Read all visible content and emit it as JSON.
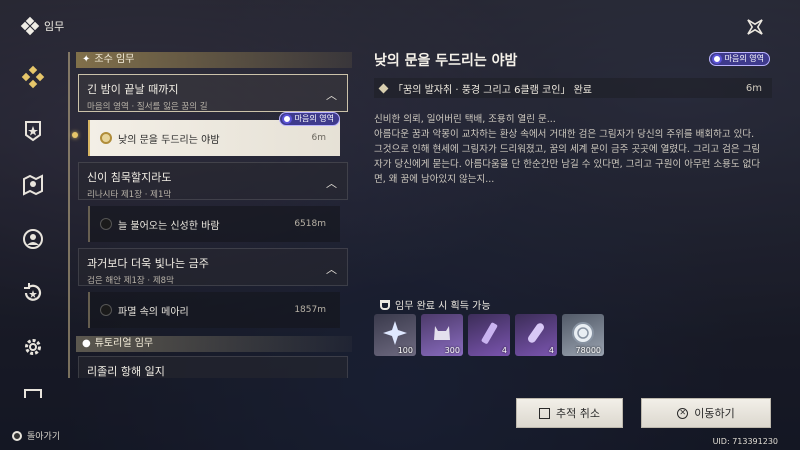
{
  "header": {
    "title": "임무"
  },
  "nav": [
    "quest-diamond",
    "shield-star",
    "map-pin",
    "person-circle",
    "refresh-star",
    "gear"
  ],
  "back_label": "돌아가기",
  "list": {
    "category_main": "조수 임무",
    "groups": [
      {
        "title": "긴 밤이 끝날 때까지",
        "subtitle": "마음의 영역 · 질서를 잃은 꿈의 길"
      },
      {
        "title": "신이 침묵할지라도",
        "subtitle": "리나시타 제1장 · 제1막"
      },
      {
        "title": "과거보다 더욱 빛나는 금주",
        "subtitle": "검은 해안 제1장 · 제8막"
      }
    ],
    "quests": [
      {
        "label": "낮의 문을 두드리는 야밤",
        "distance": "6m"
      },
      {
        "label": "늘 불어오는 신성한 바람",
        "distance": "6518m"
      },
      {
        "label": "파멸 속의 메아리",
        "distance": "1857m"
      }
    ],
    "badge_label": "마음의 영역",
    "category_tutorial": "튜토리얼 임무",
    "partial_title": "리졸리 항해 일지"
  },
  "detail": {
    "title": "낮의 문을 두드리는 야밤",
    "badge": "마음의 영역",
    "objective": "「꿈의 발자취 · 풍경 그리고 6클램 코인」 완료",
    "objective_distance": "6m",
    "description": "신비한 의뢰, 일어버린 택배, 조용히 열린 문...\n아름다운 꿈과 악몽이 교차하는 환상 속에서 거대한 검은 그림자가 당신의 주위를 배회하고 있다. 그것으로 인해 현세에 그림자가 드리워졌고, 꿈의 세계 문이 금주 곳곳에 열렸다. 그리고 검은 그림자가 당신에게 묻는다. 아름다움을 단 한순간만 남길 수 있다면, 그리고 구원이 아무런 소용도 없다면, 왜 꿈에 남아있지 않는지...",
    "rewards_label": "임무 완료 시 획득 가능",
    "rewards": [
      {
        "name": "star-crystal-icon",
        "qty": "100"
      },
      {
        "name": "cat-figure-icon",
        "qty": "300"
      },
      {
        "name": "purple-tube-icon",
        "qty": "4"
      },
      {
        "name": "purple-capsule-icon",
        "qty": "4"
      },
      {
        "name": "shell-coin-icon",
        "qty": "78000"
      }
    ]
  },
  "buttons": {
    "cancel": "추적 취소",
    "go": "이동하기"
  },
  "uid": "UID: 713391230",
  "colors": {
    "accent_gold": "#e6c66a",
    "badge_purple": "#3e3a8c"
  }
}
